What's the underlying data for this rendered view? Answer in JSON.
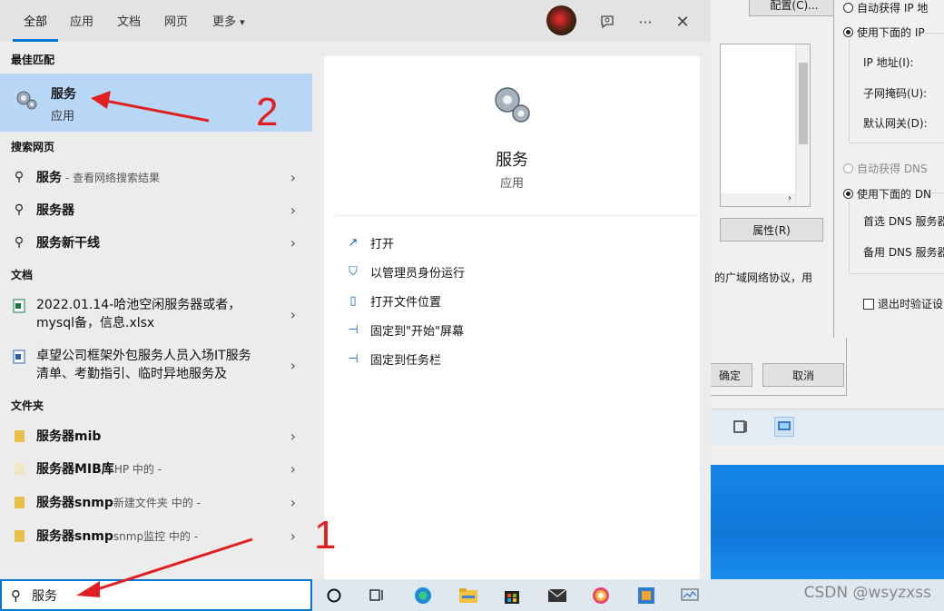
{
  "tabs": [
    "全部",
    "应用",
    "文档",
    "网页",
    "更多"
  ],
  "more_dropdown_icon": "▾",
  "toolbar_icons": [
    "account-avatar",
    "feedback-icon",
    "more-icon",
    "close-icon"
  ],
  "left": {
    "best_match_header": "最佳匹配",
    "best_match": {
      "title": "服务",
      "subtitle": "应用"
    },
    "web_header": "搜索网页",
    "web_items": [
      {
        "bold": "服务",
        "rest": " - 查看网络搜索结果"
      },
      {
        "bold": "服务",
        "rest": "器"
      },
      {
        "bold": "服务",
        "rest": "新干线"
      }
    ],
    "docs_header": "文档",
    "doc_items": [
      {
        "text": "2022.01.14-哈池空闲服务器或者，mysql备，信息.xlsx"
      },
      {
        "text": "卓望公司框架外包服务人员入场IT服务清单、考勤指引、临时异地服务及"
      }
    ],
    "folders_header": "文件夹",
    "folder_items": [
      {
        "name": "服务器mib",
        "location": ""
      },
      {
        "name": "服务器MIB库",
        "location": "HP 中的 -"
      },
      {
        "name": "服务器snmp",
        "location": "新建文件夹 中的 -"
      },
      {
        "name": "服务器snmp",
        "location": "snmp监控 中的 -"
      }
    ]
  },
  "detail": {
    "title": "服务",
    "subtitle": "应用",
    "actions": [
      "打开",
      "以管理员身份运行",
      "打开文件位置",
      "固定到\"开始\"屏幕",
      "固定到任务栏"
    ]
  },
  "search": {
    "value": "服务"
  },
  "annotations": {
    "one": "1",
    "two": "2"
  },
  "background": {
    "configure_button": "配置(C)...",
    "properties_button": "属性(R)",
    "description": "的广域网络协议，用",
    "ok_button": "确定",
    "cancel_button": "取消",
    "ip_auto": "自动获得 IP 地",
    "ip_manual": "使用下面的 IP",
    "ip_address": "IP 地址(I):",
    "subnet": "子网掩码(U):",
    "gateway": "默认网关(D):",
    "dns_auto": "自动获得 DNS",
    "dns_manual": "使用下面的 DN",
    "dns_primary": "首选 DNS 服务器",
    "dns_alternate": "备用 DNS 服务器",
    "validate_on_exit": "退出时验证设"
  },
  "watermark": "CSDN @wsyzxss",
  "colors": {
    "accent": "#0078d4",
    "selected": "#b8d6f5",
    "annotation": "#e02020"
  }
}
